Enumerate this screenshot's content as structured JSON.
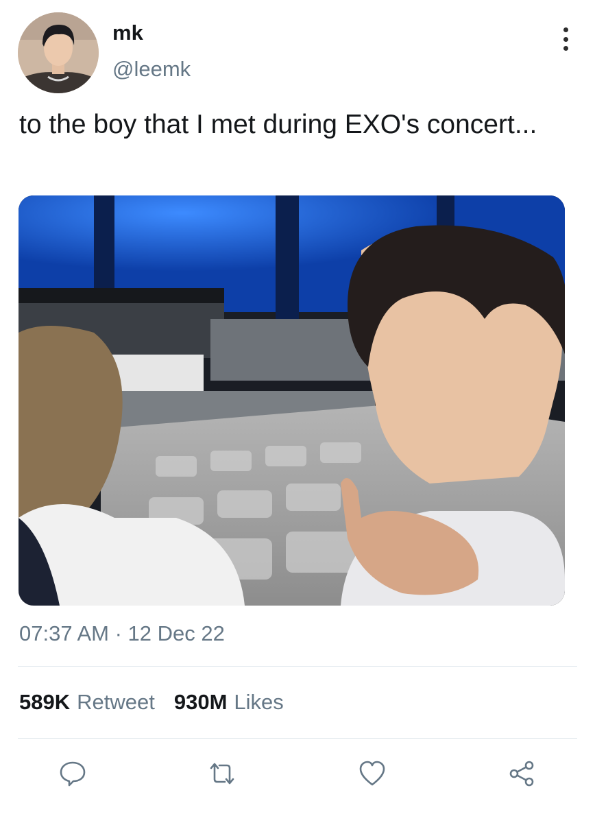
{
  "tweet": {
    "author": {
      "name": "mk",
      "handle": "@leemk"
    },
    "text": "to the boy that I met during EXO's concert...",
    "timestamp": "07:37 AM · 12 Dec 22",
    "stats": {
      "retweets_count": "589K",
      "retweets_label": "Retweet",
      "likes_count": "930M",
      "likes_label": "Likes"
    }
  },
  "icons": {
    "more": "more-vertical-icon",
    "reply": "reply-icon",
    "retweet": "retweet-icon",
    "like": "heart-icon",
    "share": "share-icon"
  },
  "colors": {
    "text_primary": "#14171a",
    "text_secondary": "#657786",
    "divider": "#e1e8ed",
    "stadium_blue": "#1e6fe0"
  }
}
